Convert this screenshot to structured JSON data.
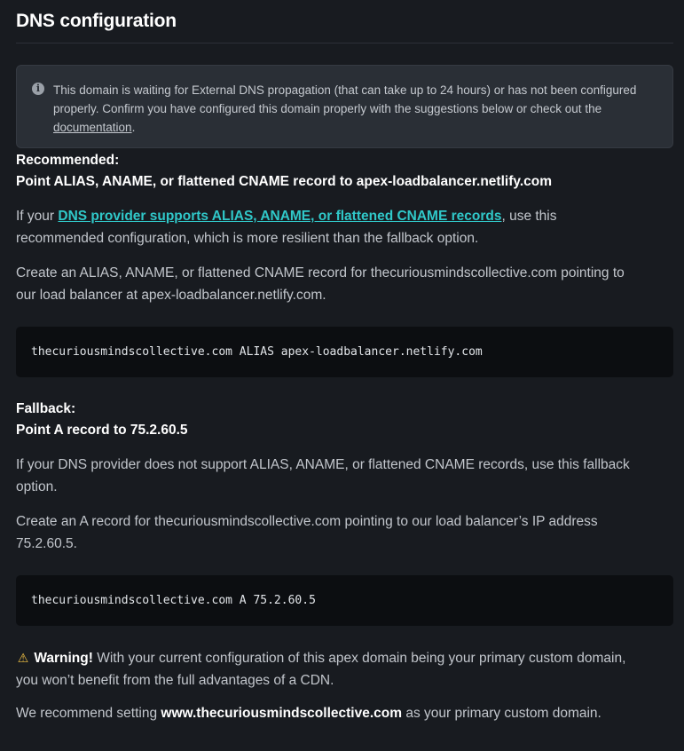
{
  "title": "DNS configuration",
  "notice": {
    "text": "This domain is waiting for External DNS propagation (that can take up to 24 hours) or has not been configured properly. Confirm you have configured this domain properly with the suggestions below or check out the ",
    "link": "documentation",
    "end": "."
  },
  "recommended": {
    "label": "Recommended:",
    "heading": "Point ALIAS, ANAME, or flattened CNAME record to apex-loadbalancer.netlify.com",
    "p1_pre": "If your ",
    "p1_link": "DNS provider supports ALIAS, ANAME, or flattened CNAME records",
    "p1_post": ", use this recommended configuration, which is more resilient than the fallback option.",
    "p2": "Create an ALIAS, ANAME, or flattened CNAME record for thecuriousmindscollective.com pointing to our load balancer at apex-loadbalancer.netlify.com.",
    "code": "thecuriousmindscollective.com ALIAS apex-loadbalancer.netlify.com"
  },
  "fallback": {
    "label": "Fallback:",
    "heading": "Point A record to 75.2.60.5",
    "p1": "If your DNS provider does not support ALIAS, ANAME, or flattened CNAME records, use this fallback option.",
    "p2": "Create an A record for thecuriousmindscollective.com pointing to our load balancer’s IP address 75.2.60.5.",
    "code": "thecuriousmindscollective.com A 75.2.60.5"
  },
  "warning": {
    "icon": "warning-icon",
    "label": "Warning!",
    "text": " With your current configuration of this apex domain being your primary custom domain, you won’t benefit from the full advantages of a CDN."
  },
  "recommend": {
    "pre": "We recommend setting ",
    "domain": "www.thecuriousmindscollective.com",
    "post": " as your primary custom domain."
  }
}
